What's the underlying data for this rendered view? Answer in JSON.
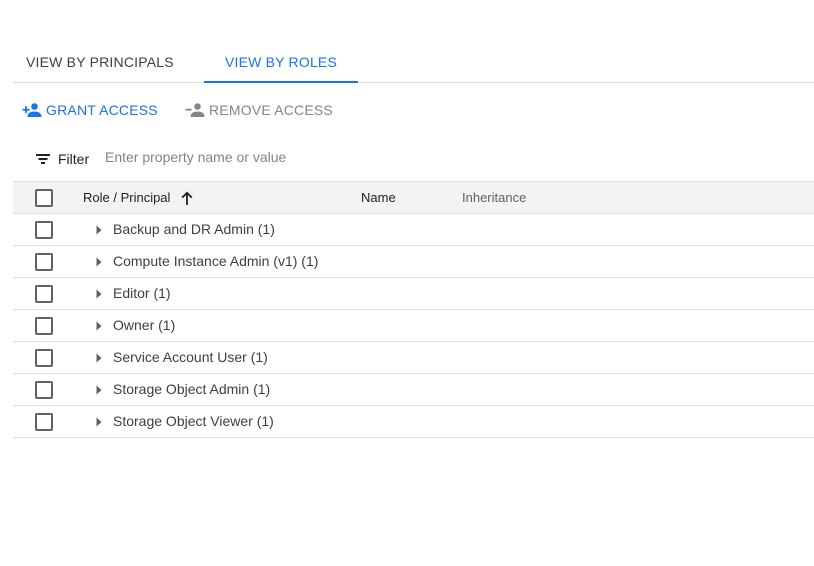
{
  "tabs": [
    {
      "label": "VIEW BY PRINCIPALS",
      "active": false
    },
    {
      "label": "VIEW BY ROLES",
      "active": true
    }
  ],
  "actions": {
    "grant_label": "GRANT ACCESS",
    "remove_label": "REMOVE ACCESS"
  },
  "filter": {
    "label": "Filter",
    "placeholder": "Enter property name or value"
  },
  "table": {
    "columns": {
      "role_principal": "Role / Principal",
      "name": "Name",
      "inheritance": "Inheritance"
    },
    "sort_icon": "arrow-up-icon",
    "rows": [
      {
        "label": "Backup and DR Admin (1)"
      },
      {
        "label": "Compute Instance Admin (v1) (1)"
      },
      {
        "label": "Editor (1)"
      },
      {
        "label": "Owner (1)"
      },
      {
        "label": "Service Account User (1)"
      },
      {
        "label": "Storage Object Admin (1)"
      },
      {
        "label": "Storage Object Viewer (1)"
      }
    ]
  },
  "colors": {
    "accent": "#1a73e8",
    "disabled": "#80868b",
    "header_bg": "#f1f3f4"
  }
}
